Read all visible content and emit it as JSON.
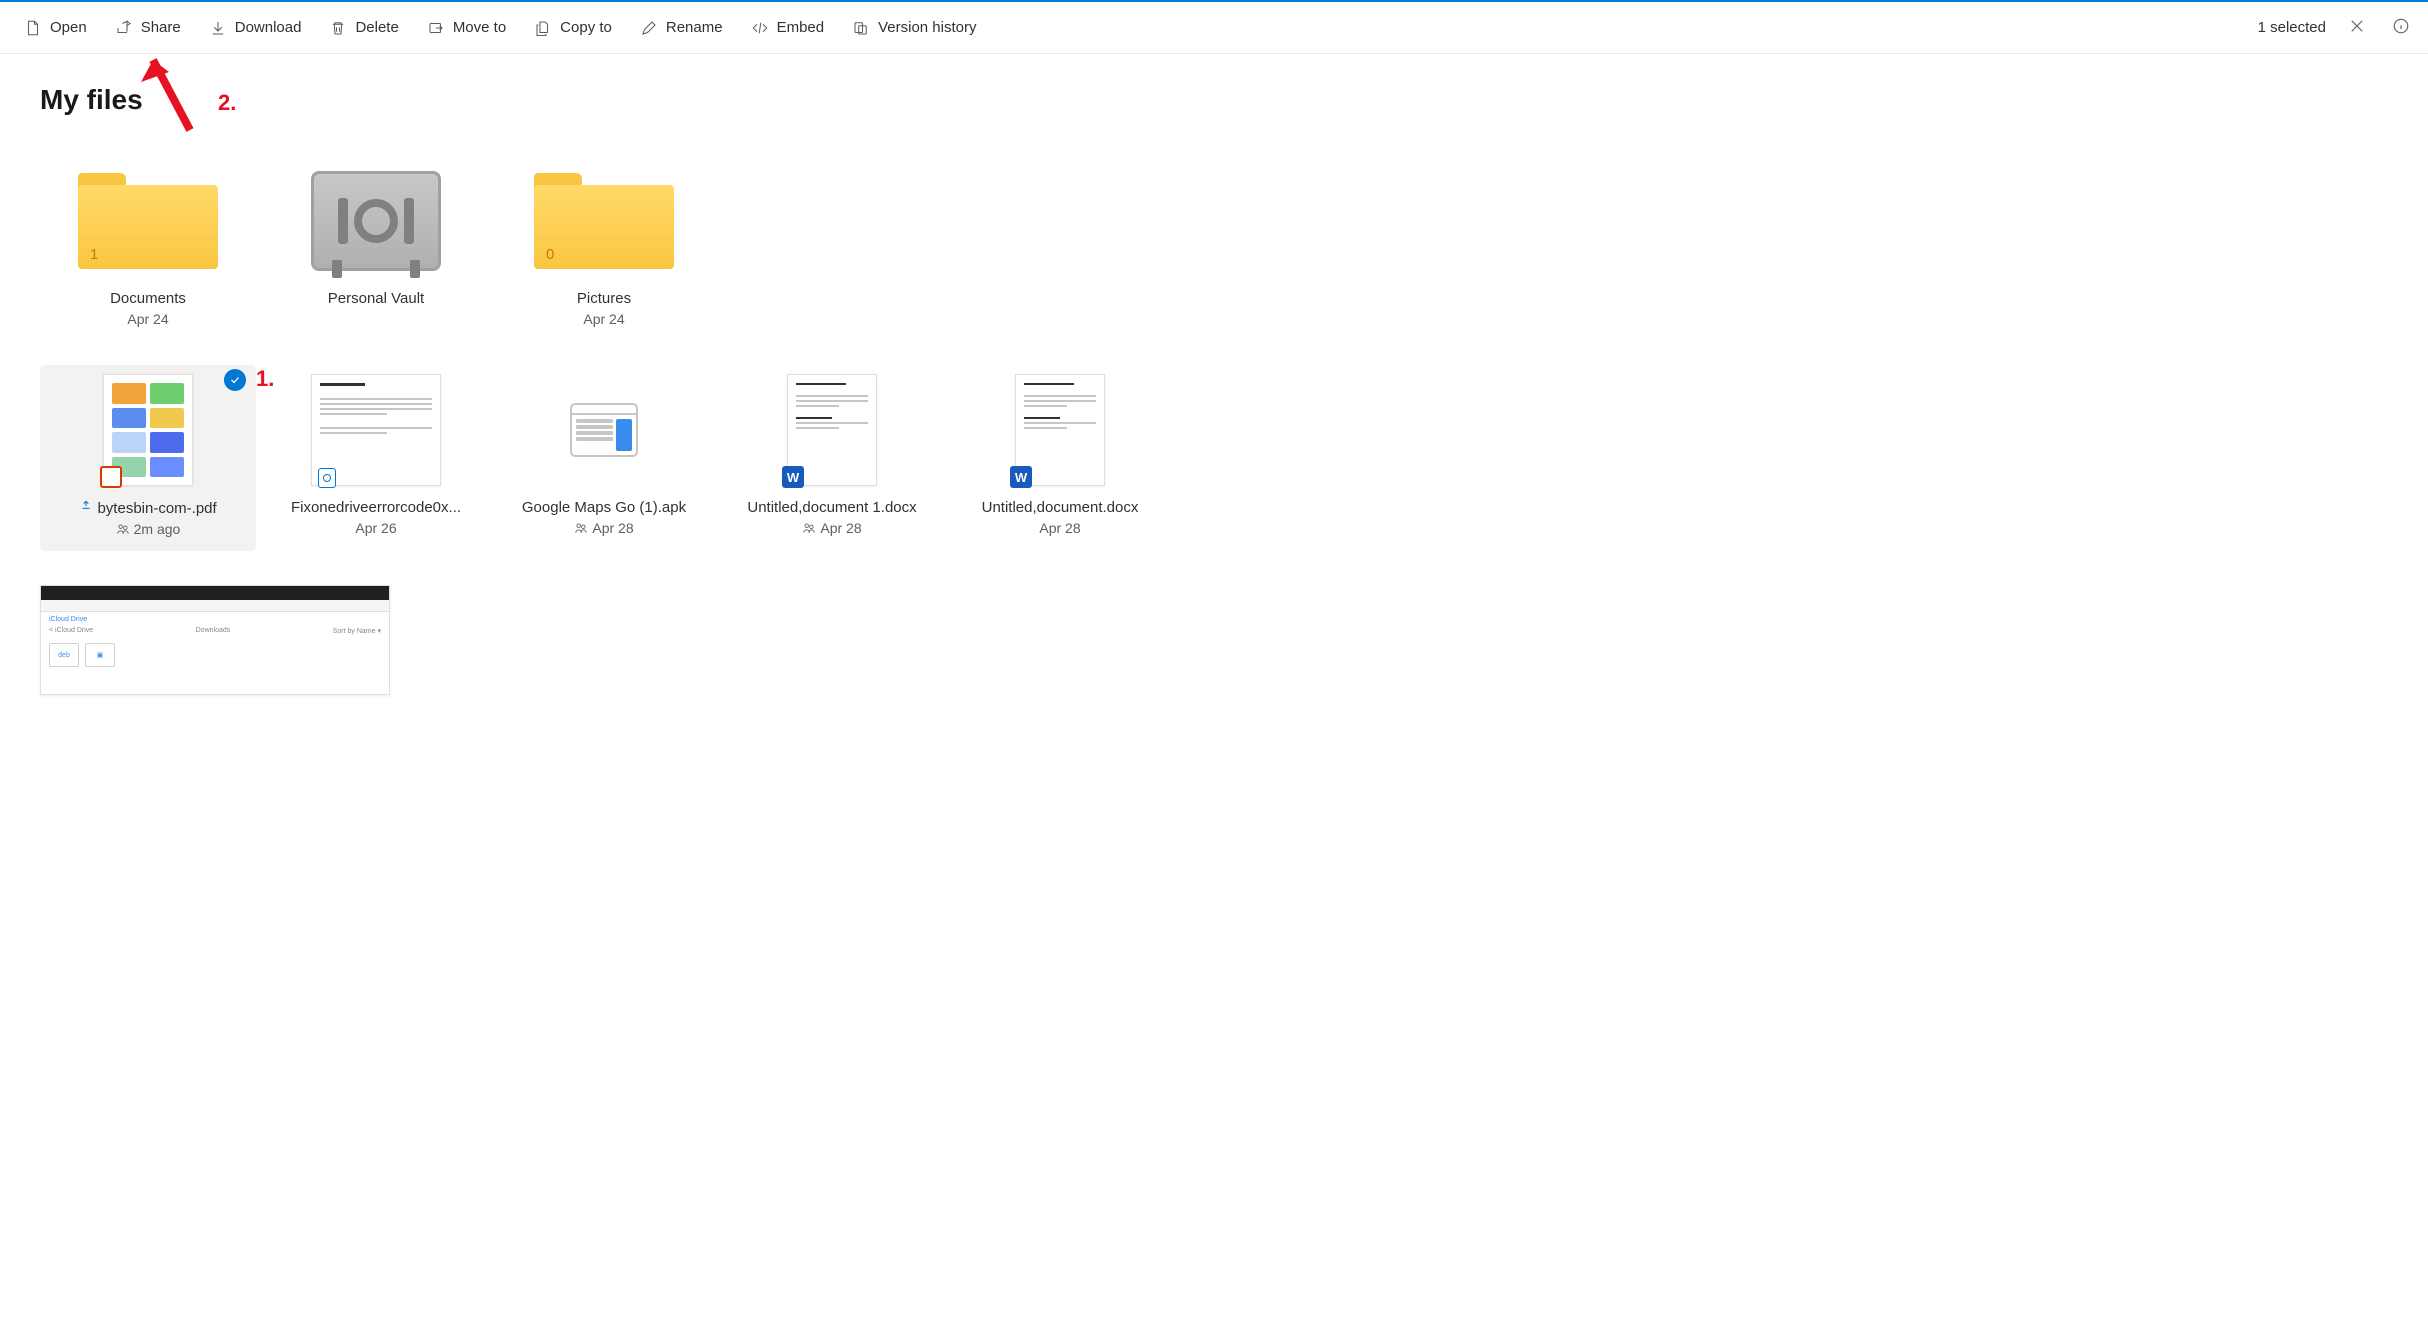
{
  "toolbar": {
    "open": "Open",
    "share": "Share",
    "download": "Download",
    "delete": "Delete",
    "move_to": "Move to",
    "copy_to": "Copy to",
    "rename": "Rename",
    "embed": "Embed",
    "version_history": "Version history",
    "selected_text": "1 selected"
  },
  "page": {
    "title": "My files"
  },
  "annotations": {
    "label1": "1.",
    "label2": "2."
  },
  "items": [
    {
      "name": "Documents",
      "meta": "Apr 24",
      "type": "folder",
      "count": "1"
    },
    {
      "name": "Personal Vault",
      "meta": "",
      "type": "vault"
    },
    {
      "name": "Pictures",
      "meta": "Apr 24",
      "type": "folder",
      "count": "0"
    },
    {
      "name": "bytesbin-com-.pdf",
      "meta": "2m ago",
      "type": "pdf",
      "selected": true,
      "shared": true,
      "new": true
    },
    {
      "name": "Fixonedriveerrorcode0x...",
      "meta": "Apr 26",
      "type": "doc"
    },
    {
      "name": "Google Maps Go (1).apk",
      "meta": "Apr 28",
      "type": "apk",
      "shared": true
    },
    {
      "name": "Untitled,document 1.docx",
      "meta": "Apr 28",
      "type": "word",
      "shared": true
    },
    {
      "name": "Untitled,document.docx",
      "meta": "Apr 28",
      "type": "word"
    },
    {
      "name": "",
      "meta": "",
      "type": "screenshot"
    }
  ]
}
